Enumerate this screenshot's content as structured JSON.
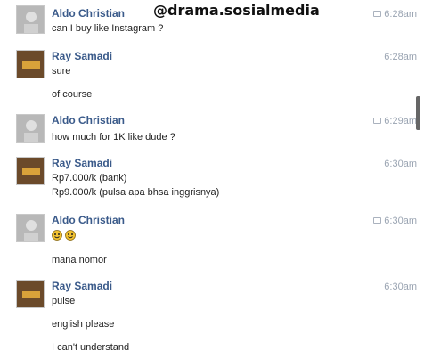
{
  "watermark": "@drama.sosialmedia",
  "messages": [
    {
      "sender": "Aldo Christian",
      "time": "6:28am",
      "lines": [
        "can I buy like Instagram ?"
      ]
    },
    {
      "sender": "Ray Samadi",
      "time": "6:28am",
      "lines": [
        "sure",
        "of course"
      ]
    },
    {
      "sender": "Aldo Christian",
      "time": "6:29am",
      "lines": [
        "how much for 1K like dude ?"
      ]
    },
    {
      "sender": "Ray Samadi",
      "time": "6:30am",
      "lines": [
        "Rp7.000/k (bank)",
        "Rp9.000/k (pulsa apa bhsa inggrisnya)"
      ]
    },
    {
      "sender": "Aldo Christian",
      "time": "6:30am",
      "lines": [
        "mana nomor"
      ]
    },
    {
      "sender": "Ray Samadi",
      "time": "6:30am",
      "lines": [
        "pulse",
        "english please",
        "I can't understand"
      ]
    }
  ],
  "icons": {
    "aldo_avatar": "person-photo-avatar",
    "ray_avatar": "logo-avatar",
    "message_status": "chat-bubble-icon",
    "emoji": "smiley-face-icon"
  },
  "colors": {
    "sender_name": "#3a5a8a",
    "timestamp": "#9aa4b2",
    "text": "#222222"
  }
}
